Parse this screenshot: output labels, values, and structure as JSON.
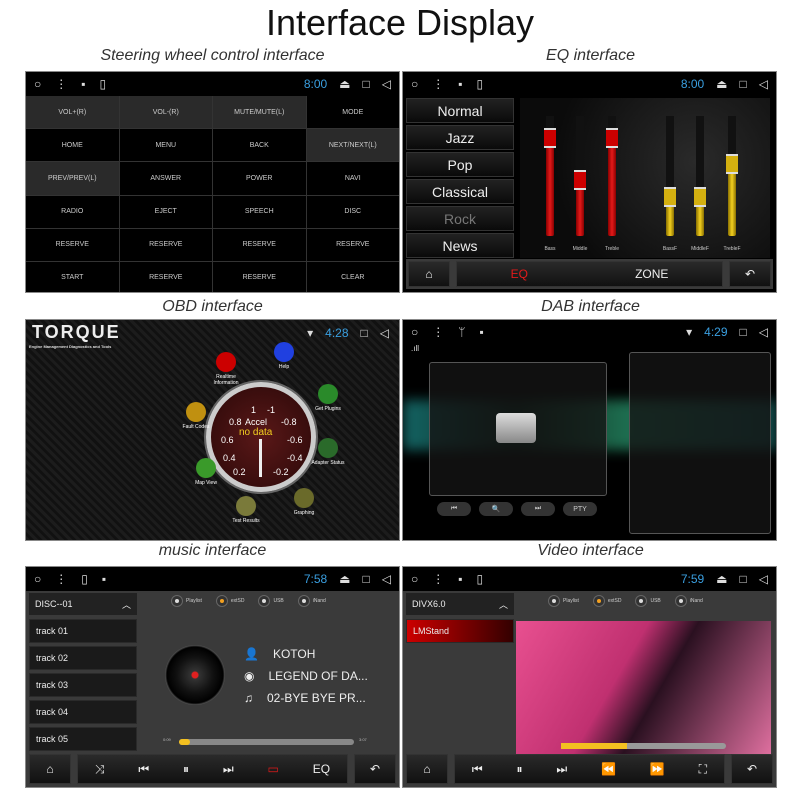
{
  "title": "Interface Display",
  "captions": {
    "steering": "Steering wheel control interface",
    "eq": "EQ  interface",
    "obd": "OBD interface",
    "dab": "DAB  interface",
    "music": "music interface",
    "video": "Video  interface"
  },
  "steering": {
    "time": "8:00",
    "buttons": [
      "VOL+(R)",
      "VOL-(R)",
      "MUTE/MUTE(L)",
      "MODE",
      "HOME",
      "MENU",
      "BACK",
      "NEXT/NEXT(L)",
      "PREV/PREV(L)",
      "ANSWER",
      "POWER",
      "NAVI",
      "RADIO",
      "EJECT",
      "SPEECH",
      "DISC",
      "RESERVE",
      "RESERVE",
      "RESERVE",
      "RESERVE",
      "START",
      "RESERVE",
      "RESERVE",
      "CLEAR"
    ]
  },
  "eq": {
    "time": "8:00",
    "presets": [
      "Normal",
      "Jazz",
      "Pop",
      "Classical",
      "Rock",
      "News"
    ],
    "sliders": [
      {
        "label": "Bass",
        "level": 0.98,
        "color": "red"
      },
      {
        "label": "Middle",
        "level": 0.6,
        "color": "red"
      },
      {
        "label": "Treble",
        "level": 0.98,
        "color": "red"
      },
      {
        "label": "BassF",
        "level": 0.45,
        "color": "yellow"
      },
      {
        "label": "MiddleF",
        "level": 0.45,
        "color": "yellow"
      },
      {
        "label": "TrebleF",
        "level": 0.75,
        "color": "yellow"
      }
    ],
    "tabs": {
      "eq": "EQ",
      "zone": "ZONE"
    },
    "accent": "#e31a1a"
  },
  "obd": {
    "time": "4:28",
    "logo": "TORQUE",
    "subtitle": "Engine Management Diagnostics and Tools",
    "gauge": {
      "label": "Accel",
      "value": "no data",
      "ticks": [
        "1",
        "-1",
        "0.8",
        "-0.8",
        "0.6",
        "-0.6",
        "0.4",
        "-0.4",
        "0.2",
        "-0.2"
      ]
    },
    "icons": [
      "Realtime Information",
      "Help",
      "Get Plugins",
      "Fault Codes",
      "Adapter Status",
      "Map View",
      "Graphing",
      "Test Results"
    ]
  },
  "dab": {
    "time": "4:29",
    "buttons": [
      "⏮",
      "🔍",
      "⏭",
      "PTY"
    ]
  },
  "music": {
    "time": "7:58",
    "folder": "DISC--01",
    "tracks": [
      "track 01",
      "track 02",
      "track 03",
      "track 04",
      "track 05"
    ],
    "sources": [
      "Playlist",
      "extSD",
      "USB",
      "iNand"
    ],
    "active_source": "extSD",
    "artist": "KOTOH",
    "album": "LEGEND OF DA...",
    "song": "02-BYE BYE PR...",
    "elapsed": "0:09",
    "total": "3:07",
    "progress": 0.06,
    "eq_label": "EQ"
  },
  "video": {
    "time": "7:59",
    "folder": "DIVX6.0",
    "items": [
      "LMStand"
    ],
    "sources": [
      "Playlist",
      "extSD",
      "USB",
      "iNand"
    ],
    "active_source": "extSD",
    "progress": 0.4
  }
}
